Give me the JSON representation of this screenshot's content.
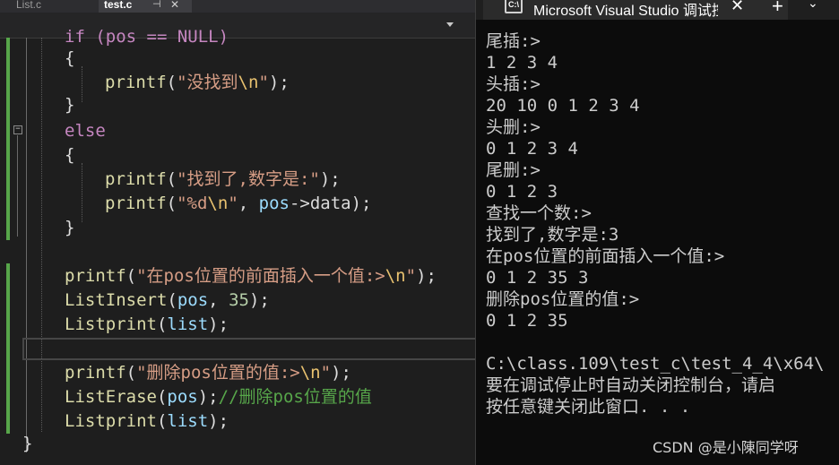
{
  "editor": {
    "tabs": [
      {
        "label": "List.c"
      },
      {
        "label": "test.c",
        "pin": "⊣",
        "close": "✕"
      }
    ],
    "code": {
      "line_if": "if (pos == NULL)",
      "line_open1": "{",
      "l1_fn": "printf",
      "l1_p": "(",
      "l1_s1": "\"没找到",
      "l1_esc": "\\n",
      "l1_s2": "\"",
      "l1_end": ");",
      "line_close1": "}",
      "line_else": "else",
      "line_open2": "{",
      "l2_fn": "printf",
      "l2_p": "(",
      "l2_s": "\"找到了,数字是:\"",
      "l2_end": ");",
      "l3_fn": "printf",
      "l3_p": "(",
      "l3_s1": "\"%d",
      "l3_esc": "\\n",
      "l3_s2": "\"",
      "l3_comma": ", ",
      "l3_var": "pos",
      "l3_arrow": "->data);",
      "line_close2": "}",
      "l4_fn": "printf",
      "l4_p": "(",
      "l4_s1": "\"在pos位置的前面插入一个值:>",
      "l4_esc": "\\n",
      "l4_s2": "\"",
      "l4_end": ");",
      "l5_fn": "ListInsert",
      "l5_p": "(",
      "l5_var": "pos",
      "l5_comma": ", ",
      "l5_num": "35",
      "l5_end": ");",
      "l6_fn": "Listprint",
      "l6_p": "(",
      "l6_var": "list",
      "l6_end": ");",
      "l7_fn": "printf",
      "l7_p": "(",
      "l7_s1": "\"删除pos位置的值:>",
      "l7_esc": "\\n",
      "l7_s2": "\"",
      "l7_end": ");",
      "l8_fn": "ListErase",
      "l8_p": "(",
      "l8_var": "pos",
      "l8_end": ");",
      "l8_comment": "//删除pos位置的值",
      "l9_fn": "Listprint",
      "l9_p": "(",
      "l9_var": "list",
      "l9_end": ");",
      "line_close3": "}"
    },
    "fold_minus": "−",
    "colors": {
      "keyword": "#c586c0",
      "function": "#dcdcaa",
      "string": "#d69d85",
      "escape": "#e8c16f",
      "variable": "#9cdcfe",
      "number": "#b5cea8",
      "comment": "#57a64a",
      "changed_bar": "#57a64a"
    }
  },
  "console": {
    "title": "Microsoft Visual Studio 调试控制台",
    "close_symbol": "✕",
    "new_tab_symbol": "+",
    "dropdown_symbol": "⌄",
    "icon_text": "C:\\",
    "lines": [
      "尾插:>",
      "1 2 3 4",
      "头插:>",
      "20 10 0 1 2 3 4",
      "头删:>",
      "0 1 2 3 4",
      "尾删:>",
      "0 1 2 3",
      "查找一个数:>",
      "找到了,数字是:3",
      "在pos位置的前面插入一个值:>",
      "0 1 2 35 3",
      "删除pos位置的值:>",
      "0 1 2 35",
      "",
      "C:\\class.109\\test_c\\test_4_4\\x64\\",
      "要在调试停止时自动关闭控制台，请启",
      "按任意键关闭此窗口. . ."
    ],
    "watermark": "CSDN @是小陳同学呀"
  }
}
